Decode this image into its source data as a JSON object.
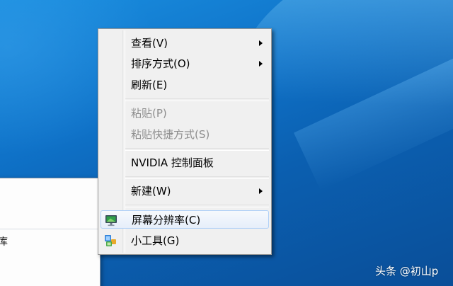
{
  "context_menu": {
    "items": [
      {
        "label": "查看(V)"
      },
      {
        "label": "排序方式(O)"
      },
      {
        "label": "刷新(E)"
      },
      {
        "label": "粘贴(P)"
      },
      {
        "label": "粘贴快捷方式(S)"
      },
      {
        "label": "NVIDIA 控制面板"
      },
      {
        "label": "新建(W)"
      },
      {
        "label": "屏幕分辨率(C)"
      },
      {
        "label": "小工具(G)"
      }
    ]
  },
  "window": {
    "fragment_text": "库"
  },
  "watermark": {
    "text": "头条 @初山p"
  },
  "icons": {
    "screen_resolution": "monitor-icon",
    "gadgets": "gadgets-icon",
    "submenu": "chevron-right-icon"
  },
  "colors": {
    "desktop_blue": "#0f72c8",
    "menu_bg": "#f0f0f0",
    "highlight_border": "#aecff7",
    "disabled_text": "#8d8d8d"
  }
}
